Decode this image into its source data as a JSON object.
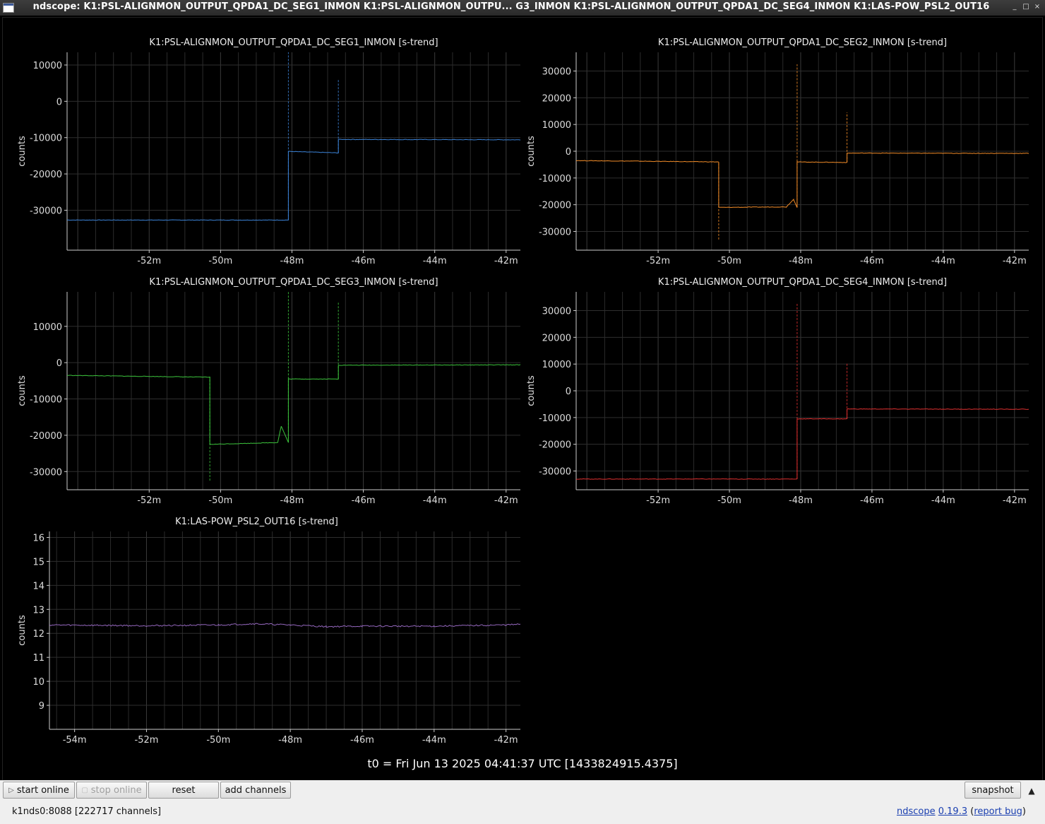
{
  "window": {
    "title": "ndscope: K1:PSL-ALIGNMON_OUTPUT_QPDA1_DC_SEG1_INMON K1:PSL-ALIGNMON_OUTPU... G3_INMON K1:PSL-ALIGNMON_OUTPUT_QPDA1_DC_SEG4_INMON K1:LAS-POW_PSL2_OUT16",
    "buttons": [
      "minimize-icon",
      "maximize-icon",
      "close-icon"
    ]
  },
  "colors": {
    "seg1": "#3b82d6",
    "seg2": "#f28c28",
    "seg3": "#3cc43c",
    "seg4": "#e03030",
    "pow": "#9467bd",
    "grid": "#2b2b2b",
    "axis": "#cccccc"
  },
  "chart_data": [
    {
      "type": "line",
      "title": "K1:PSL-ALIGNMON_OUTPUT_QPDA1_DC_SEG1_INMON [s-trend]",
      "ylabel": "counts",
      "xlabel": "",
      "xlim": [
        -54.3,
        -41.6
      ],
      "ylim": [
        -41000,
        13500
      ],
      "xticks": [
        -52,
        -50,
        -48,
        -46,
        -44,
        -42
      ],
      "xtick_labels": [
        "-52m",
        "-50m",
        "-48m",
        "-46m",
        "-44m",
        "-42m"
      ],
      "yticks": [
        10000,
        0,
        -10000,
        -20000,
        -30000
      ],
      "series": [
        {
          "color": "#3b82d6",
          "x": [
            -54.3,
            -48.1,
            -48.1,
            -46.7,
            -46.7,
            -41.6
          ],
          "y": [
            -32700,
            -32700,
            -13800,
            -14200,
            -10500,
            -10600
          ]
        }
      ],
      "spikes": [
        {
          "x": -48.1,
          "y": [
            -32700,
            13500
          ]
        },
        {
          "x": -46.7,
          "y": [
            -14200,
            6000
          ]
        }
      ],
      "grid": true
    },
    {
      "type": "line",
      "title": "K1:PSL-ALIGNMON_OUTPUT_QPDA1_DC_SEG2_INMON [s-trend]",
      "ylabel": "counts",
      "xlabel": "",
      "xlim": [
        -54.3,
        -41.6
      ],
      "ylim": [
        -37000,
        37000
      ],
      "xticks": [
        -52,
        -50,
        -48,
        -46,
        -44,
        -42
      ],
      "xtick_labels": [
        "-52m",
        "-50m",
        "-48m",
        "-46m",
        "-44m",
        "-42m"
      ],
      "yticks": [
        30000,
        20000,
        10000,
        0,
        -10000,
        -20000,
        -30000
      ],
      "series": [
        {
          "color": "#f28c28",
          "x": [
            -54.3,
            -50.3,
            -50.3,
            -48.4,
            -48.2,
            -48.1,
            -48.1,
            -46.7,
            -46.7,
            -41.6
          ],
          "y": [
            -3500,
            -4000,
            -21000,
            -20800,
            -18000,
            -21000,
            -4000,
            -4200,
            -700,
            -800
          ]
        }
      ],
      "spikes": [
        {
          "x": -50.3,
          "y": [
            -33000,
            -4000
          ]
        },
        {
          "x": -48.1,
          "y": [
            -21000,
            32500
          ]
        },
        {
          "x": -46.7,
          "y": [
            -4200,
            14500
          ]
        }
      ],
      "grid": true
    },
    {
      "type": "line",
      "title": "K1:PSL-ALIGNMON_OUTPUT_QPDA1_DC_SEG3_INMON [s-trend]",
      "ylabel": "counts",
      "xlabel": "",
      "xlim": [
        -54.3,
        -41.6
      ],
      "ylim": [
        -35000,
        19500
      ],
      "xticks": [
        -52,
        -50,
        -48,
        -46,
        -44,
        -42
      ],
      "xtick_labels": [
        "-52m",
        "-50m",
        "-48m",
        "-46m",
        "-44m",
        "-42m"
      ],
      "yticks": [
        10000,
        0,
        -10000,
        -20000,
        -30000
      ],
      "series": [
        {
          "color": "#3cc43c",
          "x": [
            -54.3,
            -50.3,
            -50.3,
            -48.4,
            -48.3,
            -48.1,
            -48.1,
            -46.7,
            -46.7,
            -41.6
          ],
          "y": [
            -3500,
            -4000,
            -22500,
            -22000,
            -17500,
            -22000,
            -4500,
            -4500,
            -700,
            -600
          ]
        }
      ],
      "spikes": [
        {
          "x": -50.3,
          "y": [
            -32500,
            -4000
          ]
        },
        {
          "x": -48.1,
          "y": [
            -22000,
            19500
          ]
        },
        {
          "x": -46.7,
          "y": [
            -4500,
            16500
          ]
        }
      ],
      "grid": true
    },
    {
      "type": "line",
      "title": "K1:PSL-ALIGNMON_OUTPUT_QPDA1_DC_SEG4_INMON [s-trend]",
      "ylabel": "counts",
      "xlabel": "",
      "xlim": [
        -54.3,
        -41.6
      ],
      "ylim": [
        -37000,
        37000
      ],
      "xticks": [
        -52,
        -50,
        -48,
        -46,
        -44,
        -42
      ],
      "xtick_labels": [
        "-52m",
        "-50m",
        "-48m",
        "-46m",
        "-44m",
        "-42m"
      ],
      "yticks": [
        30000,
        20000,
        10000,
        0,
        -10000,
        -20000,
        -30000
      ],
      "series": [
        {
          "color": "#e03030",
          "x": [
            -54.3,
            -48.1,
            -48.1,
            -46.7,
            -46.7,
            -41.6
          ],
          "y": [
            -33000,
            -33000,
            -10500,
            -10500,
            -6800,
            -6900
          ]
        }
      ],
      "spikes": [
        {
          "x": -48.1,
          "y": [
            -33000,
            32500
          ]
        },
        {
          "x": -46.7,
          "y": [
            -10500,
            10500
          ]
        }
      ],
      "grid": true
    },
    {
      "type": "line",
      "title": "K1:LAS-POW_PSL2_OUT16 [s-trend]",
      "ylabel": "counts",
      "xlabel": "",
      "xlim": [
        -54.7,
        -41.6
      ],
      "ylim": [
        8.0,
        16.25
      ],
      "xticks": [
        -54,
        -52,
        -50,
        -48,
        -46,
        -44,
        -42
      ],
      "xtick_labels": [
        "-54m",
        "-52m",
        "-50m",
        "-48m",
        "-46m",
        "-44m",
        "-42m"
      ],
      "yticks": [
        16,
        15,
        14,
        13,
        12,
        11,
        10,
        9
      ],
      "series": [
        {
          "color": "#9467bd",
          "x": [
            -54.7,
            -52,
            -50,
            -49,
            -48,
            -47,
            -46,
            -44,
            -42,
            -41.6
          ],
          "y": [
            12.35,
            12.32,
            12.35,
            12.4,
            12.35,
            12.28,
            12.3,
            12.3,
            12.35,
            12.38
          ]
        }
      ],
      "spikes": [],
      "grid": true
    }
  ],
  "footer": {
    "t0": "t0 = Fri Jun 13 2025 04:41:37 UTC [1433824915.4375]",
    "start_online": "start online",
    "stop_online": "stop online",
    "reset": "reset",
    "add_channels": "add channels",
    "snapshot": "snapshot",
    "server": "k1nds0:8088  [222717 channels]",
    "app_link": "ndscope",
    "version": "0.19.3",
    "report_bug": "report bug"
  }
}
